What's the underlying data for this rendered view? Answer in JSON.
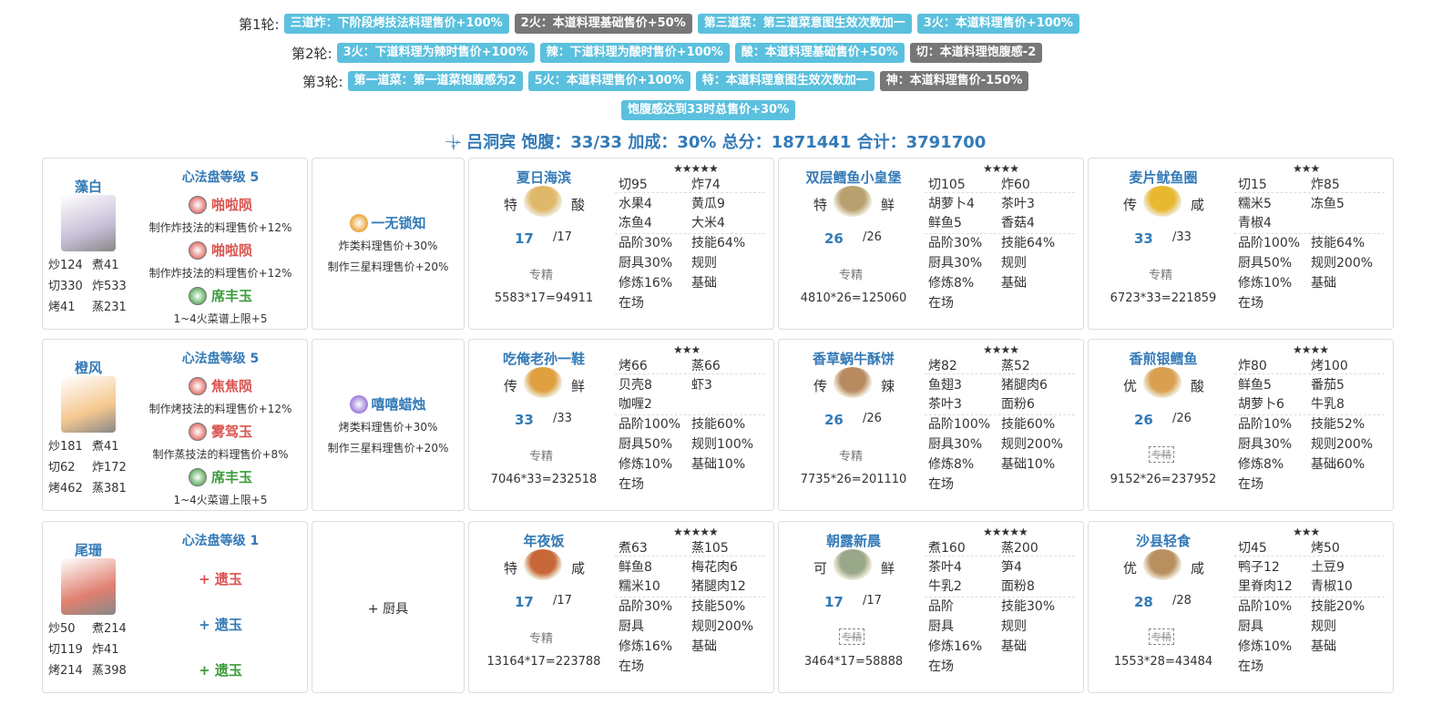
{
  "rounds": [
    {
      "label": "第1轮:",
      "tags": [
        {
          "text": "三道炸：下阶段烤技法料理售价+100%",
          "color": "blue"
        },
        {
          "text": "2火：本道料理基础售价+50%",
          "color": "gray"
        },
        {
          "text": "第三道菜：第三道菜意图生效次数加一",
          "color": "blue"
        },
        {
          "text": "3火：本道料理售价+100%",
          "color": "blue"
        }
      ]
    },
    {
      "label": "第2轮:",
      "tags": [
        {
          "text": "3火：下道料理为辣时售价+100%",
          "color": "blue"
        },
        {
          "text": "辣：下道料理为酸时售价+100%",
          "color": "blue"
        },
        {
          "text": "酸：本道料理基础售价+50%",
          "color": "blue"
        },
        {
          "text": "切：本道料理饱腹感-2",
          "color": "gray"
        }
      ]
    },
    {
      "label": "第3轮:",
      "tags": [
        {
          "text": "第一道菜：第一道菜饱腹感为2",
          "color": "blue"
        },
        {
          "text": "5火：本道料理售价+100%",
          "color": "blue"
        },
        {
          "text": "特：本道料理意图生效次数加一",
          "color": "blue"
        },
        {
          "text": "神：本道料理售价-150%",
          "color": "gray"
        }
      ]
    },
    {
      "label": "",
      "tags": [
        {
          "text": "饱腹感达到33时总售价+30%",
          "color": "blue"
        }
      ]
    }
  ],
  "summary": {
    "icon": "sword-icon",
    "text": "吕洞宾 饱腹：33/33 加成：30% 总分：1871441 合计：3791700"
  },
  "rows": [
    {
      "chef": {
        "name": "藻白",
        "portrait_color": "#c9bfd8",
        "stats": [
          "炒124",
          "煮41",
          "切330",
          "炸533",
          "烤41",
          "蒸231"
        ],
        "level": "心法盘等级 5",
        "jades": [
          {
            "name": "啪啦陨",
            "color": "#d9534f",
            "skill": "制作炸技法的料理售价+12%"
          },
          {
            "name": "啪啦陨",
            "color": "#d9534f",
            "skill": "制作炸技法的料理售价+12%"
          },
          {
            "name": "席丰玉",
            "color": "#3c9c3c",
            "skill": "1~4火菜谱上限+5"
          }
        ]
      },
      "equip": {
        "name": "一无锁知",
        "icon_color": "#e9a33a",
        "effects": [
          "炸类料理售价+30%",
          "制作三星料理售价+20%"
        ]
      },
      "dishes": [
        {
          "name": "夏日海滨",
          "rarity": "特",
          "flavor": "酸",
          "stars": "★★★★★",
          "img_color": "#e0b86a",
          "qty": "17",
          "max": "/17",
          "spec": "专精",
          "spec_box": false,
          "formula": "5583*17=94911",
          "cells": [
            "切95",
            "炸74",
            "水果4",
            "黄瓜9",
            "冻鱼4",
            "大米4",
            "品阶30%",
            "技能64%",
            "厨具30%",
            "规则",
            "修炼16%",
            "基础",
            "在场",
            ""
          ]
        },
        {
          "name": "双层鳕鱼小皇堡",
          "rarity": "特",
          "flavor": "鲜",
          "stars": "★★★★",
          "img_color": "#b8a070",
          "qty": "26",
          "max": "/26",
          "spec": "专精",
          "spec_box": false,
          "formula": "4810*26=125060",
          "cells": [
            "切105",
            "炸60",
            "胡萝卜4",
            "茶叶3",
            "鲜鱼5",
            "香菇4",
            "品阶30%",
            "技能64%",
            "厨具30%",
            "规则",
            "修炼8%",
            "基础",
            "在场",
            ""
          ]
        },
        {
          "name": "麦片鱿鱼圈",
          "rarity": "传",
          "flavor": "咸",
          "stars": "★★★",
          "img_color": "#e8b830",
          "qty": "33",
          "max": "/33",
          "spec": "专精",
          "spec_box": false,
          "formula": "6723*33=221859",
          "cells": [
            "切15",
            "炸85",
            "糯米5",
            "冻鱼5",
            "青椒4",
            "",
            "品阶100%",
            "技能64%",
            "厨具50%",
            "规则200%",
            "修炼10%",
            "基础",
            "在场",
            ""
          ]
        }
      ]
    },
    {
      "chef": {
        "name": "橙风",
        "portrait_color": "#f5c890",
        "stats": [
          "炒181",
          "煮41",
          "切62",
          "炸172",
          "烤462",
          "蒸381"
        ],
        "level": "心法盘等级 5",
        "jades": [
          {
            "name": "焦焦陨",
            "color": "#d9534f",
            "skill": "制作烤技法的料理售价+12%"
          },
          {
            "name": "雾驾玉",
            "color": "#d9534f",
            "skill": "制作蒸技法的料理售价+8%"
          },
          {
            "name": "席丰玉",
            "color": "#3c9c3c",
            "skill": "1~4火菜谱上限+5"
          }
        ]
      },
      "equip": {
        "name": "嘻嘻蜡烛",
        "icon_color": "#9b7ad8",
        "effects": [
          "烤类料理售价+30%",
          "制作三星料理售价+20%"
        ]
      },
      "dishes": [
        {
          "name": "吃俺老孙一鞋",
          "rarity": "传",
          "flavor": "鲜",
          "stars": "★★★",
          "img_color": "#e0a040",
          "qty": "33",
          "max": "/33",
          "spec": "专精",
          "spec_box": false,
          "formula": "7046*33=232518",
          "cells": [
            "烤66",
            "蒸66",
            "贝壳8",
            "虾3",
            "咖喱2",
            "",
            "品阶100%",
            "技能60%",
            "厨具50%",
            "规则100%",
            "修炼10%",
            "基础10%",
            "在场",
            ""
          ]
        },
        {
          "name": "香草蜗牛酥饼",
          "rarity": "传",
          "flavor": "辣",
          "stars": "★★★★",
          "img_color": "#b88a60",
          "qty": "26",
          "max": "/26",
          "spec": "专精",
          "spec_box": false,
          "formula": "7735*26=201110",
          "cells": [
            "烤82",
            "蒸52",
            "鱼翅3",
            "猪腿肉6",
            "茶叶3",
            "面粉6",
            "品阶100%",
            "技能60%",
            "厨具30%",
            "规则200%",
            "修炼8%",
            "基础10%",
            "在场",
            ""
          ]
        },
        {
          "name": "香煎银鳕鱼",
          "rarity": "优",
          "flavor": "酸",
          "stars": "★★★★",
          "img_color": "#d8a050",
          "qty": "26",
          "max": "/26",
          "spec": "专精",
          "spec_box": true,
          "formula": "9152*26=237952",
          "cells": [
            "炸80",
            "烤100",
            "鲜鱼5",
            "番茄5",
            "胡萝卜6",
            "牛乳8",
            "品阶10%",
            "技能52%",
            "厨具30%",
            "规则200%",
            "修炼8%",
            "基础60%",
            "在场",
            ""
          ]
        }
      ]
    },
    {
      "chef": {
        "name": "尾珊",
        "portrait_color": "#e08070",
        "stats": [
          "炒50",
          "煮214",
          "切119",
          "炸41",
          "烤214",
          "蒸398"
        ],
        "level": "心法盘等级 1",
        "add_jades": [
          {
            "text": "+ 遗玉",
            "color": "#d9534f"
          },
          {
            "text": "+ 遗玉",
            "color": "#337ab7"
          },
          {
            "text": "+ 遗玉",
            "color": "#3c9c3c"
          }
        ]
      },
      "equip": {
        "add_text": "+ 厨具"
      },
      "dishes": [
        {
          "name": "年夜饭",
          "rarity": "特",
          "flavor": "咸",
          "stars": "★★★★★",
          "img_color": "#c86838",
          "qty": "17",
          "max": "/17",
          "spec": "专精",
          "spec_box": false,
          "formula": "13164*17=223788",
          "cells": [
            "煮63",
            "蒸105",
            "鲜鱼8",
            "梅花肉6",
            "糯米10",
            "猪腿肉12",
            "品阶30%",
            "技能50%",
            "厨具",
            "规则200%",
            "修炼16%",
            "基础",
            "在场",
            ""
          ]
        },
        {
          "name": "朝露新晨",
          "rarity": "可",
          "flavor": "鲜",
          "stars": "★★★★★",
          "img_color": "#98a888",
          "qty": "17",
          "max": "/17",
          "spec": "专精",
          "spec_box": true,
          "formula": "3464*17=58888",
          "cells": [
            "煮160",
            "蒸200",
            "茶叶4",
            "笋4",
            "牛乳2",
            "面粉8",
            "品阶",
            "技能30%",
            "厨具",
            "规则",
            "修炼16%",
            "基础",
            "在场",
            ""
          ]
        },
        {
          "name": "沙县轻食",
          "rarity": "优",
          "flavor": "咸",
          "stars": "★★★",
          "img_color": "#b89060",
          "qty": "28",
          "max": "/28",
          "spec": "专精",
          "spec_box": true,
          "formula": "1553*28=43484",
          "cells": [
            "切45",
            "烤50",
            "鸭子12",
            "土豆9",
            "里脊肉12",
            "青椒10",
            "品阶10%",
            "技能20%",
            "厨具",
            "规则",
            "修炼10%",
            "基础",
            "在场",
            ""
          ]
        }
      ]
    }
  ]
}
